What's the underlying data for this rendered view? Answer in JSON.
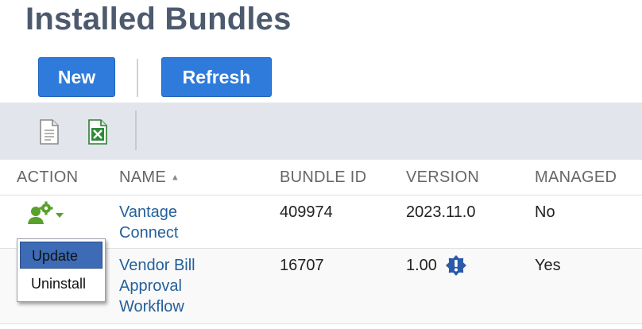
{
  "header": {
    "title": "Installed Bundles"
  },
  "buttons": {
    "new_label": "New",
    "refresh_label": "Refresh"
  },
  "toolbar": {
    "icons": [
      "document-icon",
      "excel-export-icon"
    ]
  },
  "table": {
    "columns": [
      "ACTION",
      "NAME",
      "BUNDLE ID",
      "VERSION",
      "MANAGED"
    ],
    "sort_indicator": "▲",
    "rows": [
      {
        "name_line1": "Vantage",
        "name_line2": "Connect",
        "name_line3": "",
        "bundle_id": "409974",
        "version": "2023.11.0",
        "managed": "No"
      },
      {
        "name_line1": "Vendor Bill",
        "name_line2": "Approval",
        "name_line3": "Workflow",
        "bundle_id": "16707",
        "version": "1.00",
        "managed": "Yes"
      }
    ]
  },
  "action_menu": {
    "items": [
      "Update",
      "Uninstall"
    ],
    "highlighted": "Update"
  },
  "colors": {
    "title": "#4d5a6e",
    "button": "#2f7bdb",
    "link": "#25609a",
    "gear": "#5aa02c",
    "warn": "#2a5aa8",
    "menu_highlight": "#3d6bb5"
  }
}
